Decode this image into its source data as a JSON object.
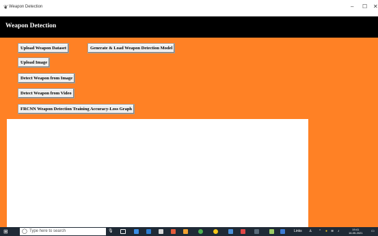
{
  "window": {
    "title": "Weapon Detection",
    "controls": {
      "minimize": "–",
      "maximize": "☐",
      "close": "✕"
    }
  },
  "banner": {
    "heading": "Weapon Detection"
  },
  "buttons": {
    "upload_dataset": "Upload Weapon Dataset",
    "generate_model": "Generate & Load Weapon Detection Model",
    "upload_image": "Upload Image",
    "detect_image": "Detect Weapon from Image",
    "detect_video": "Detect Weapon from Video",
    "frcnn_graph": "FRCNN Weapon Detection Training Accuracy-Loss Graph"
  },
  "taskbar": {
    "search_placeholder": "Type here to search",
    "links_label": "Links",
    "time": "19:41",
    "date": "16-05-2021"
  },
  "colors": {
    "background": "#ff8125",
    "banner": "#000000",
    "output_area": "#ffffff",
    "taskbar": "#1f2a36"
  }
}
